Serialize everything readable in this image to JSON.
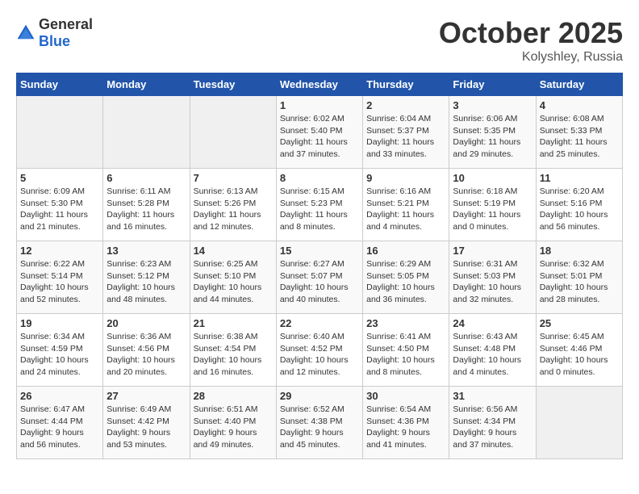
{
  "header": {
    "logo_general": "General",
    "logo_blue": "Blue",
    "month": "October 2025",
    "location": "Kolyshley, Russia"
  },
  "days_of_week": [
    "Sunday",
    "Monday",
    "Tuesday",
    "Wednesday",
    "Thursday",
    "Friday",
    "Saturday"
  ],
  "weeks": [
    [
      {
        "day": "",
        "info": ""
      },
      {
        "day": "",
        "info": ""
      },
      {
        "day": "",
        "info": ""
      },
      {
        "day": "1",
        "info": "Sunrise: 6:02 AM\nSunset: 5:40 PM\nDaylight: 11 hours\nand 37 minutes."
      },
      {
        "day": "2",
        "info": "Sunrise: 6:04 AM\nSunset: 5:37 PM\nDaylight: 11 hours\nand 33 minutes."
      },
      {
        "day": "3",
        "info": "Sunrise: 6:06 AM\nSunset: 5:35 PM\nDaylight: 11 hours\nand 29 minutes."
      },
      {
        "day": "4",
        "info": "Sunrise: 6:08 AM\nSunset: 5:33 PM\nDaylight: 11 hours\nand 25 minutes."
      }
    ],
    [
      {
        "day": "5",
        "info": "Sunrise: 6:09 AM\nSunset: 5:30 PM\nDaylight: 11 hours\nand 21 minutes."
      },
      {
        "day": "6",
        "info": "Sunrise: 6:11 AM\nSunset: 5:28 PM\nDaylight: 11 hours\nand 16 minutes."
      },
      {
        "day": "7",
        "info": "Sunrise: 6:13 AM\nSunset: 5:26 PM\nDaylight: 11 hours\nand 12 minutes."
      },
      {
        "day": "8",
        "info": "Sunrise: 6:15 AM\nSunset: 5:23 PM\nDaylight: 11 hours\nand 8 minutes."
      },
      {
        "day": "9",
        "info": "Sunrise: 6:16 AM\nSunset: 5:21 PM\nDaylight: 11 hours\nand 4 minutes."
      },
      {
        "day": "10",
        "info": "Sunrise: 6:18 AM\nSunset: 5:19 PM\nDaylight: 11 hours\nand 0 minutes."
      },
      {
        "day": "11",
        "info": "Sunrise: 6:20 AM\nSunset: 5:16 PM\nDaylight: 10 hours\nand 56 minutes."
      }
    ],
    [
      {
        "day": "12",
        "info": "Sunrise: 6:22 AM\nSunset: 5:14 PM\nDaylight: 10 hours\nand 52 minutes."
      },
      {
        "day": "13",
        "info": "Sunrise: 6:23 AM\nSunset: 5:12 PM\nDaylight: 10 hours\nand 48 minutes."
      },
      {
        "day": "14",
        "info": "Sunrise: 6:25 AM\nSunset: 5:10 PM\nDaylight: 10 hours\nand 44 minutes."
      },
      {
        "day": "15",
        "info": "Sunrise: 6:27 AM\nSunset: 5:07 PM\nDaylight: 10 hours\nand 40 minutes."
      },
      {
        "day": "16",
        "info": "Sunrise: 6:29 AM\nSunset: 5:05 PM\nDaylight: 10 hours\nand 36 minutes."
      },
      {
        "day": "17",
        "info": "Sunrise: 6:31 AM\nSunset: 5:03 PM\nDaylight: 10 hours\nand 32 minutes."
      },
      {
        "day": "18",
        "info": "Sunrise: 6:32 AM\nSunset: 5:01 PM\nDaylight: 10 hours\nand 28 minutes."
      }
    ],
    [
      {
        "day": "19",
        "info": "Sunrise: 6:34 AM\nSunset: 4:59 PM\nDaylight: 10 hours\nand 24 minutes."
      },
      {
        "day": "20",
        "info": "Sunrise: 6:36 AM\nSunset: 4:56 PM\nDaylight: 10 hours\nand 20 minutes."
      },
      {
        "day": "21",
        "info": "Sunrise: 6:38 AM\nSunset: 4:54 PM\nDaylight: 10 hours\nand 16 minutes."
      },
      {
        "day": "22",
        "info": "Sunrise: 6:40 AM\nSunset: 4:52 PM\nDaylight: 10 hours\nand 12 minutes."
      },
      {
        "day": "23",
        "info": "Sunrise: 6:41 AM\nSunset: 4:50 PM\nDaylight: 10 hours\nand 8 minutes."
      },
      {
        "day": "24",
        "info": "Sunrise: 6:43 AM\nSunset: 4:48 PM\nDaylight: 10 hours\nand 4 minutes."
      },
      {
        "day": "25",
        "info": "Sunrise: 6:45 AM\nSunset: 4:46 PM\nDaylight: 10 hours\nand 0 minutes."
      }
    ],
    [
      {
        "day": "26",
        "info": "Sunrise: 6:47 AM\nSunset: 4:44 PM\nDaylight: 9 hours\nand 56 minutes."
      },
      {
        "day": "27",
        "info": "Sunrise: 6:49 AM\nSunset: 4:42 PM\nDaylight: 9 hours\nand 53 minutes."
      },
      {
        "day": "28",
        "info": "Sunrise: 6:51 AM\nSunset: 4:40 PM\nDaylight: 9 hours\nand 49 minutes."
      },
      {
        "day": "29",
        "info": "Sunrise: 6:52 AM\nSunset: 4:38 PM\nDaylight: 9 hours\nand 45 minutes."
      },
      {
        "day": "30",
        "info": "Sunrise: 6:54 AM\nSunset: 4:36 PM\nDaylight: 9 hours\nand 41 minutes."
      },
      {
        "day": "31",
        "info": "Sunrise: 6:56 AM\nSunset: 4:34 PM\nDaylight: 9 hours\nand 37 minutes."
      },
      {
        "day": "",
        "info": ""
      }
    ]
  ]
}
